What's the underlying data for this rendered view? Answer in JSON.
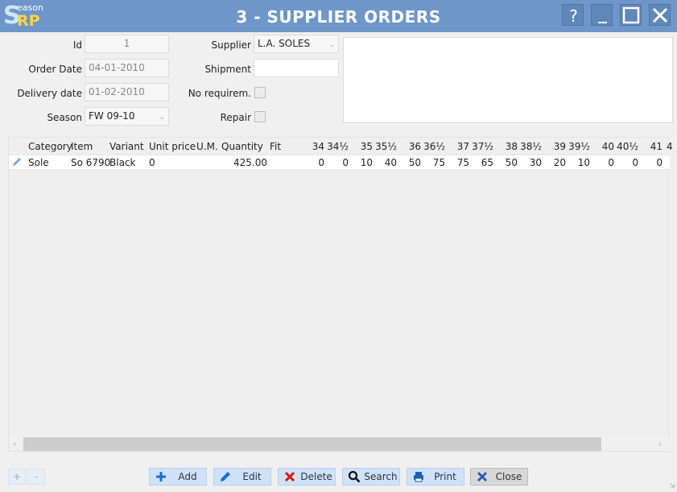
{
  "window": {
    "title": "3 - SUPPLIER ORDERS",
    "logo": {
      "s": "S",
      "season": "eason",
      "rp": "RP"
    }
  },
  "form": {
    "id": {
      "label": "Id",
      "value": "1"
    },
    "order_date": {
      "label": "Order Date",
      "value": "04-01-2010"
    },
    "delivery_date": {
      "label": "Delivery date",
      "value": "01-02-2010"
    },
    "season": {
      "label": "Season",
      "value": "FW 09-10"
    },
    "supplier": {
      "label": "Supplier",
      "value": "L.A. SOLES"
    },
    "shipment": {
      "label": "Shipment",
      "value": ""
    },
    "no_requirement": {
      "label": "No requirem.",
      "checked": false
    },
    "repair": {
      "label": "Repair",
      "checked": false
    }
  },
  "grid": {
    "columns": [
      "Category",
      "Item",
      "Variant",
      "Unit price",
      "U.M.",
      "Quantity",
      "Fit",
      "34",
      "34½",
      "35",
      "35½",
      "36",
      "36½",
      "37",
      "37½",
      "38",
      "38½",
      "39",
      "39½",
      "40",
      "40½",
      "41",
      "4"
    ],
    "rows": [
      {
        "category": "Sole",
        "item": "So 6790",
        "variant": "Black",
        "unit_price": "0",
        "um": "",
        "quantity": "425.00",
        "fit": "",
        "sizes": [
          "0",
          "0",
          "10",
          "40",
          "50",
          "75",
          "75",
          "65",
          "50",
          "30",
          "20",
          "10",
          "0",
          "0",
          "0"
        ]
      }
    ]
  },
  "footer": {
    "plus": "+",
    "minus": "-",
    "add": "Add",
    "edit": "Edit",
    "delete": "Delete",
    "search": "Search",
    "print": "Print",
    "close": "Close"
  },
  "colors": {
    "titlebar": "#6e96c8",
    "button": "#cfe2fa",
    "accent_logo": "#ffd24a"
  }
}
